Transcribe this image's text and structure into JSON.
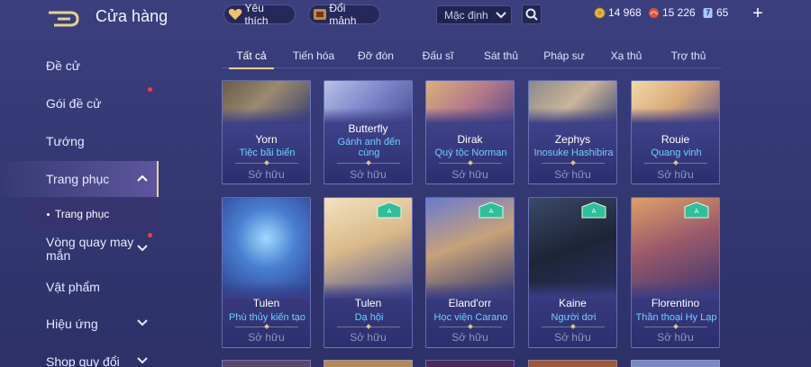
{
  "header": {
    "title": "Cửa hàng",
    "favorites_label": "Yêu thích",
    "fragments_label": "Đổi mảnh",
    "sort_value": "Mặc định",
    "currency": {
      "gold": "14 968",
      "ruby": "15 226",
      "voucher": "65"
    },
    "plus_label": "+"
  },
  "sidebar": {
    "items": [
      {
        "label": "Đề cử"
      },
      {
        "label": "Gói đề cử"
      },
      {
        "label": "Tướng"
      },
      {
        "label": "Trang phục"
      },
      {
        "label": "Vòng quay may mắn"
      },
      {
        "label": "Vật phẩm"
      },
      {
        "label": "Hiệu ứng"
      },
      {
        "label": "Shop quy đổi"
      }
    ],
    "sub_item": "Trang phục"
  },
  "tabs": [
    "Tất cả",
    "Tiến hóa",
    "Đỡ đòn",
    "Đấu sĩ",
    "Sát thủ",
    "Pháp sư",
    "Xạ thủ",
    "Trợ thủ"
  ],
  "cards": [
    {
      "hero": "Yorn",
      "skin": "Tiệc bãi biển",
      "status": "Sở hữu"
    },
    {
      "hero": "Butterfly",
      "skin": "Gánh anh đến cùng",
      "status": "Sở hữu"
    },
    {
      "hero": "Dirak",
      "skin": "Quý tộc Norman",
      "status": "Sở hữu"
    },
    {
      "hero": "Zephys",
      "skin": "Inosuke Hashibira",
      "status": "Sở hữu"
    },
    {
      "hero": "Rouie",
      "skin": "Quang vinh",
      "status": "Sở hữu"
    },
    {
      "hero": "Tulen",
      "skin": "Phù thủy kiến tạo",
      "status": "Sở hữu"
    },
    {
      "hero": "Tulen",
      "skin": "Dạ hội",
      "status": "Sở hữu"
    },
    {
      "hero": "Eland'orr",
      "skin": "Học viện Carano",
      "status": "Sở hữu"
    },
    {
      "hero": "Kaine",
      "skin": "Người dơi",
      "status": "Sở hữu"
    },
    {
      "hero": "Florentino",
      "skin": "Thần thoại Hy Lạp",
      "status": "Sở hữu"
    }
  ],
  "colors": {
    "accent_gold": "#e9d18f",
    "skin_name": "#6fd0ff",
    "notification": "#ff3a3a"
  }
}
